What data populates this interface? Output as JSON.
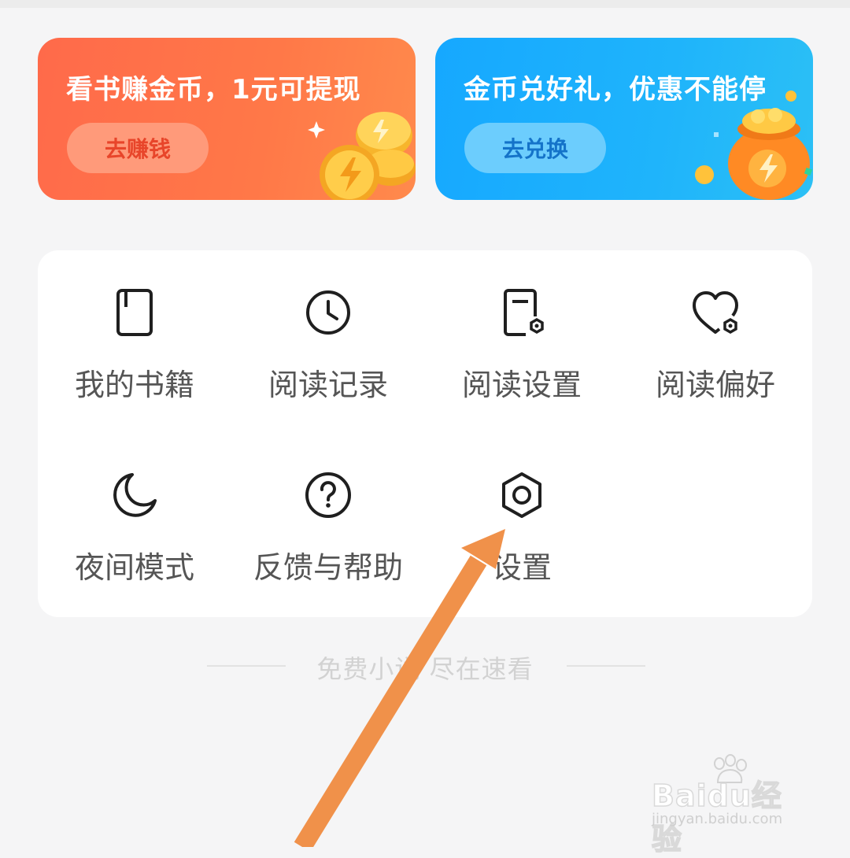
{
  "banners": {
    "earn": {
      "title": "看书赚金币，1元可提现",
      "button": "去赚钱"
    },
    "redeem": {
      "title": "金币兑好礼，优惠不能停",
      "button": "去兑换"
    }
  },
  "menu": {
    "my_books": "我的书籍",
    "reading_history": "阅读记录",
    "reading_settings": "阅读设置",
    "reading_preferences": "阅读偏好",
    "night_mode": "夜间模式",
    "feedback_help": "反馈与帮助",
    "settings": "设置"
  },
  "footer": {
    "slogan": "免费小说 尽在速看"
  },
  "watermark": {
    "brand": "Baidu经验",
    "url": "jingyan.baidu.com"
  },
  "colors": {
    "earn_banner": "#ff6a4a",
    "redeem_banner": "#16a8ff",
    "annotation_arrow": "#f0914a"
  }
}
